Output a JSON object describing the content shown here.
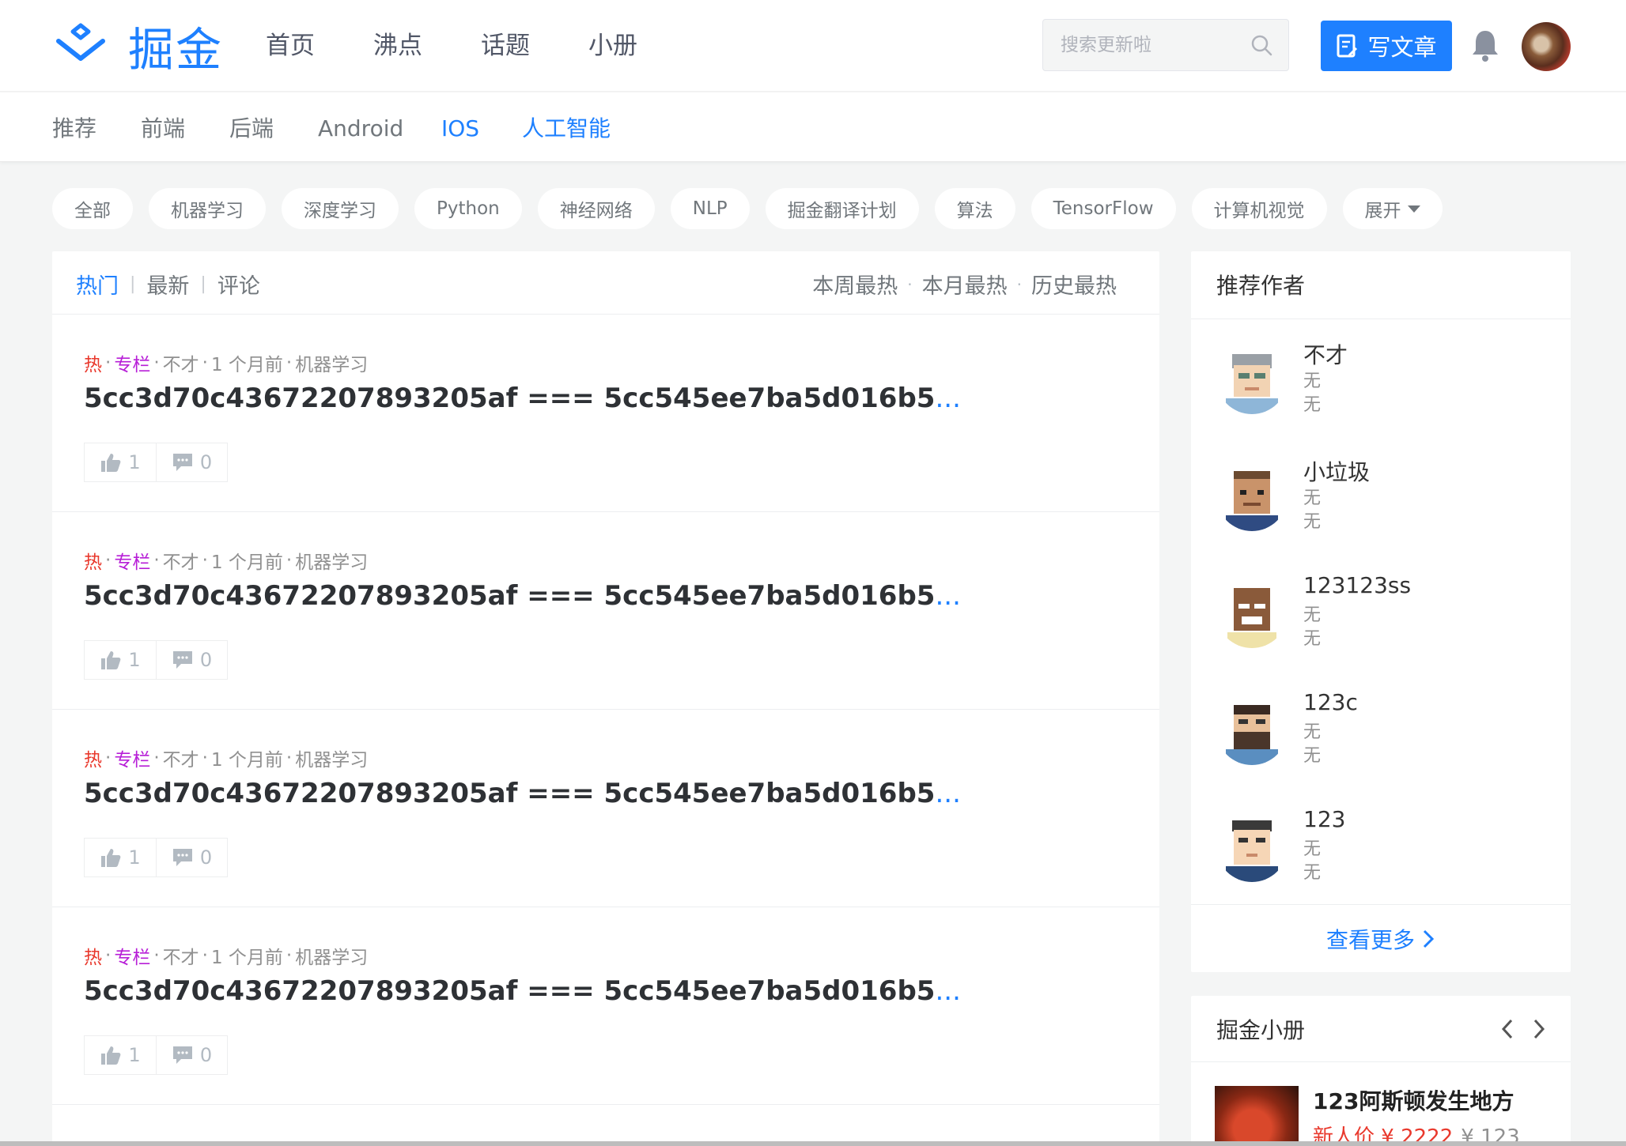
{
  "header": {
    "logo_text": "掘金",
    "nav": [
      {
        "label": "首页"
      },
      {
        "label": "沸点"
      },
      {
        "label": "话题"
      },
      {
        "label": "小册"
      }
    ],
    "search_placeholder": "搜索更新啦",
    "write_label": "写文章"
  },
  "categories": [
    {
      "label": "推荐",
      "active": false
    },
    {
      "label": "前端",
      "active": false
    },
    {
      "label": "后端",
      "active": false
    },
    {
      "label": "Android",
      "active": false
    },
    {
      "label": "IOS",
      "active": true
    },
    {
      "label": "人工智能",
      "active": true
    }
  ],
  "tags": [
    "全部",
    "机器学习",
    "深度学习",
    "Python",
    "神经网络",
    "NLP",
    "掘金翻译计划",
    "算法",
    "TensorFlow",
    "计算机视觉"
  ],
  "tags_expand": "展开",
  "feed": {
    "sort_left": [
      "热门",
      "最新",
      "评论"
    ],
    "sort_right": [
      "本周最热",
      "本月最热",
      "历史最热"
    ],
    "entries": [
      {
        "hot": "热",
        "column": "专栏",
        "author": "不才",
        "time": "1 个月前",
        "tag": "机器学习",
        "title": "5cc3d70c43672207893205af === 5cc545ee7ba5d016b5",
        "ellipsis": "...",
        "likes": "1",
        "comments": "0"
      },
      {
        "hot": "热",
        "column": "专栏",
        "author": "不才",
        "time": "1 个月前",
        "tag": "机器学习",
        "title": "5cc3d70c43672207893205af === 5cc545ee7ba5d016b5",
        "ellipsis": "...",
        "likes": "1",
        "comments": "0"
      },
      {
        "hot": "热",
        "column": "专栏",
        "author": "不才",
        "time": "1 个月前",
        "tag": "机器学习",
        "title": "5cc3d70c43672207893205af === 5cc545ee7ba5d016b5",
        "ellipsis": "...",
        "likes": "1",
        "comments": "0"
      },
      {
        "hot": "热",
        "column": "专栏",
        "author": "不才",
        "time": "1 个月前",
        "tag": "机器学习",
        "title": "5cc3d70c43672207893205af === 5cc545ee7ba5d016b5",
        "ellipsis": "...",
        "likes": "1",
        "comments": "0"
      }
    ]
  },
  "authors": {
    "title": "推荐作者",
    "items": [
      {
        "name": "不才",
        "line2": "无",
        "line3": "无"
      },
      {
        "name": "小垃圾",
        "line2": "无",
        "line3": "无"
      },
      {
        "name": "123123ss",
        "line2": "无",
        "line3": "无"
      },
      {
        "name": "123c",
        "line2": "无",
        "line3": "无"
      },
      {
        "name": "123",
        "line2": "无",
        "line3": "无"
      }
    ],
    "more_label": "查看更多"
  },
  "books": {
    "title": "掘金小册",
    "item": {
      "title": "123阿斯顿发生地方",
      "price": "新人价 ¥ 2222",
      "old_price": "¥ 123"
    }
  },
  "colors": {
    "accent": "#1e80ff",
    "hot": "#e9392d",
    "column": "#b71ed7"
  }
}
